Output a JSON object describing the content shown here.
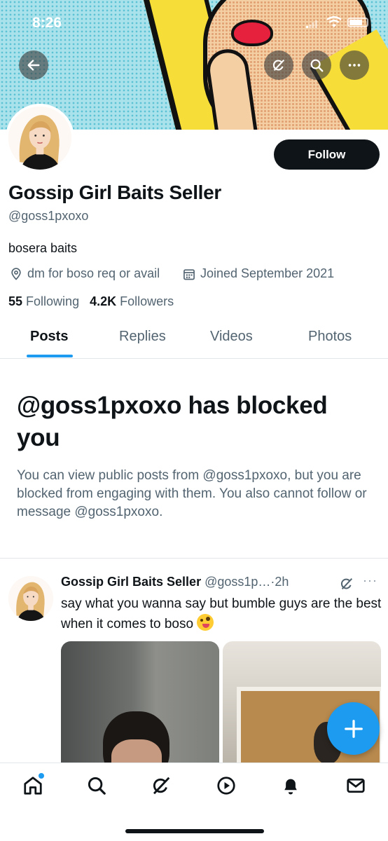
{
  "status_bar": {
    "time": "8:26"
  },
  "profile": {
    "name": "Gossip Girl Baits Seller",
    "handle": "@goss1pxoxo",
    "bio": "bosera baits",
    "location": "dm for boso req or avail",
    "joined": "Joined September 2021",
    "following_count": "55",
    "following_label": "Following",
    "followers_count": "4.2K",
    "followers_label": "Followers",
    "follow_label": "Follow"
  },
  "tabs": [
    {
      "label": "Posts",
      "active": true
    },
    {
      "label": "Replies",
      "active": false
    },
    {
      "label": "Videos",
      "active": false
    },
    {
      "label": "Photos",
      "active": false
    }
  ],
  "blocked": {
    "title": "@goss1pxoxo has blocked you",
    "description": "You can view public posts from @goss1pxoxo, but you are blocked from engaging with them. You also cannot follow or message @goss1pxoxo."
  },
  "post": {
    "author_name": "Gossip Girl Baits Seller",
    "author_handle": "@goss1p…",
    "separator": "·",
    "time": "2h",
    "text": "say what you wanna say but bumble guys are the best when it comes to boso",
    "more_label": "···"
  },
  "colors": {
    "accent": "#1d9bf0",
    "text": "#0f1419",
    "secondary": "#536471"
  },
  "icons": {
    "banner": [
      "back-arrow-icon",
      "grok-icon",
      "search-icon",
      "more-icon"
    ],
    "nav": [
      "home-icon",
      "search-icon",
      "grok-icon",
      "video-icon",
      "notifications-icon",
      "messages-icon"
    ],
    "meta": [
      "location-icon",
      "calendar-icon"
    ],
    "emoji": "zany-face-emoji"
  }
}
